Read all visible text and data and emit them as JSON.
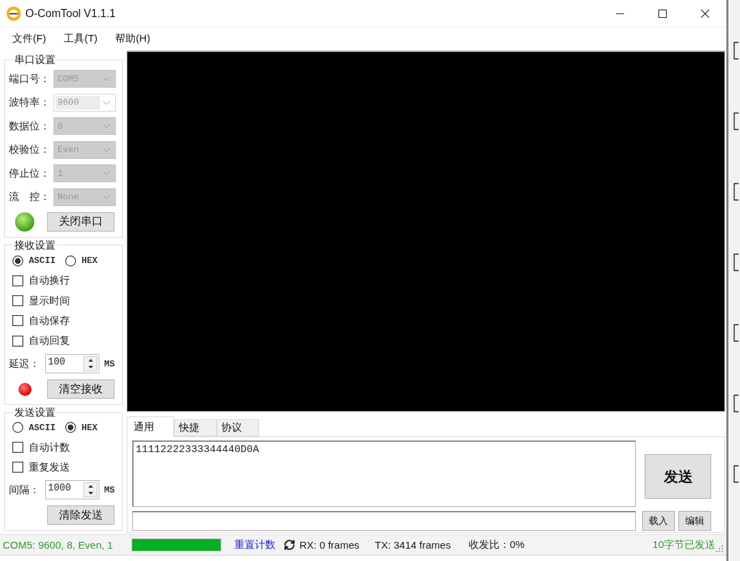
{
  "window": {
    "title": "O-ComTool V1.1.1"
  },
  "menu": [
    {
      "label": "文件(F)"
    },
    {
      "label": "工具(T)"
    },
    {
      "label": "帮助(H)"
    }
  ],
  "serial_settings": {
    "title": "串口设置",
    "fields": [
      {
        "label": "端口号：",
        "value": "COM5",
        "editable": false,
        "disabled": true
      },
      {
        "label": "波特率：",
        "value": "9600",
        "editable": true,
        "disabled": true
      },
      {
        "label": "数据位：",
        "value": "8",
        "editable": false,
        "disabled": true
      },
      {
        "label": "校验位：",
        "value": "Even",
        "editable": false,
        "disabled": true
      },
      {
        "label": "停止位：",
        "value": "1",
        "editable": false,
        "disabled": true
      },
      {
        "label": "流　控：",
        "value": "None",
        "editable": false,
        "disabled": true
      }
    ],
    "connected": true,
    "button": "关闭串口"
  },
  "receive_settings": {
    "title": "接收设置",
    "modes": [
      {
        "label": "ASCII",
        "selected": true
      },
      {
        "label": "HEX",
        "selected": false
      }
    ],
    "options": [
      {
        "label": "自动换行",
        "checked": false
      },
      {
        "label": "显示时间",
        "checked": false
      },
      {
        "label": "自动保存",
        "checked": false
      },
      {
        "label": "自动回复",
        "checked": false
      }
    ],
    "delay": {
      "label": "延迟：",
      "value": "100",
      "unit": "MS"
    },
    "indicator_lit": true,
    "button": "清空接收"
  },
  "send_settings": {
    "title": "发送设置",
    "modes": [
      {
        "label": "ASCII",
        "selected": false
      },
      {
        "label": "HEX",
        "selected": true
      }
    ],
    "options": [
      {
        "label": "自动计数",
        "checked": false
      },
      {
        "label": "重复发送",
        "checked": false
      }
    ],
    "interval": {
      "label": "间隔：",
      "value": "1000",
      "unit": "MS"
    },
    "button": "清除发送"
  },
  "tabs": [
    {
      "label": "通用",
      "selected": true
    },
    {
      "label": "快捷",
      "selected": false
    },
    {
      "label": "协议",
      "selected": false
    }
  ],
  "send_panel": {
    "text": "11112222333344440D0A",
    "send_button": "发送",
    "buttons": [
      "载入",
      "编辑"
    ]
  },
  "status_bar": {
    "port_info": "COM5: 9600, 8, Even, 1",
    "progress": {
      "level": 1
    },
    "reset_link": "重置计数",
    "rx": "RX: 0 frames",
    "tx": "TX: 3414 frames",
    "ratio": "收发比：0%",
    "sent_info": "10字节已发送"
  }
}
